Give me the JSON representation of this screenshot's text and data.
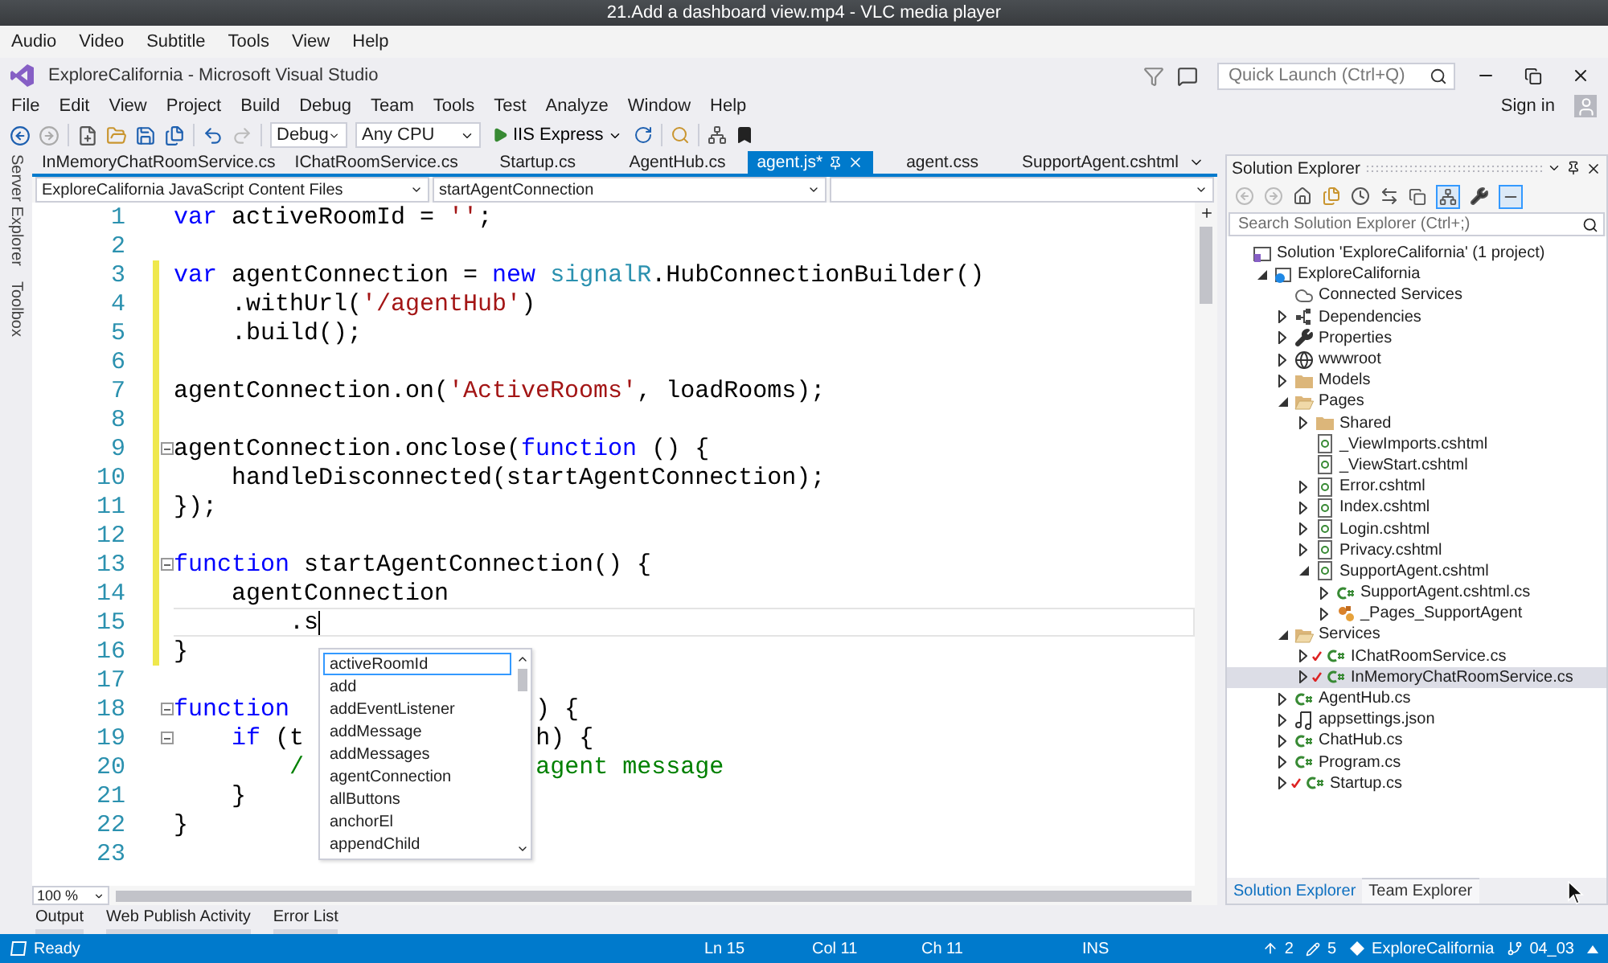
{
  "player": {
    "title": "21.Add a dashboard view.mp4 - VLC media player",
    "menu": [
      "Audio",
      "Video",
      "Subtitle",
      "Tools",
      "View",
      "Help"
    ]
  },
  "window": {
    "title": "ExploreCalifornia - Microsoft Visual Studio",
    "quick_launch": {
      "placeholder": "Quick Launch (Ctrl+Q)"
    }
  },
  "menu": [
    "File",
    "Edit",
    "View",
    "Project",
    "Build",
    "Debug",
    "Team",
    "Tools",
    "Test",
    "Analyze",
    "Window",
    "Help"
  ],
  "account": "Sign in",
  "toolbar": {
    "configuration": "Debug",
    "platform": "Any CPU",
    "run_target": "IIS Express"
  },
  "side_tabs": [
    "Server Explorer",
    "Toolbox"
  ],
  "editor": {
    "tabs": [
      {
        "label": "InMemoryChatRoomService.cs",
        "selected": false
      },
      {
        "label": "IChatRoomService.cs",
        "selected": false
      },
      {
        "label": "Startup.cs",
        "selected": false
      },
      {
        "label": "AgentHub.cs",
        "selected": false
      },
      {
        "label": "agent.js*",
        "selected": true
      },
      {
        "label": "agent.css",
        "selected": false
      },
      {
        "label": "SupportAgent.cshtml",
        "selected": false
      }
    ],
    "navigation": {
      "project": "ExploreCalifornia JavaScript Content Files",
      "member": "startAgentConnection"
    },
    "lines": [
      {
        "number": "1",
        "changed": false,
        "fold": false,
        "current": false,
        "runs": [
          [
            {
              "kind": "kw",
              "text": "var"
            },
            {
              "kind": "plain",
              "text": " activeRoomId = "
            },
            {
              "kind": "str",
              "text": "''"
            },
            {
              "kind": "plain",
              "text": ";"
            }
          ]
        ]
      },
      {
        "number": "2",
        "changed": false,
        "fold": false,
        "current": false
      },
      {
        "number": "3",
        "changed": true,
        "fold": false,
        "current": false,
        "runs": [
          [
            {
              "kind": "kw",
              "text": "var"
            },
            {
              "kind": "plain",
              "text": " agentConnection = "
            },
            {
              "kind": "kw",
              "text": "new"
            },
            {
              "kind": "type",
              "text": " signalR"
            },
            {
              "kind": "plain",
              "text": ".HubConnectionBuilder()"
            }
          ]
        ]
      },
      {
        "number": "4",
        "changed": true,
        "fold": false,
        "current": false,
        "runs": [
          [
            {
              "kind": "plain",
              "text": "    .withUrl("
            },
            {
              "kind": "str",
              "text": "'/agentHub'"
            },
            {
              "kind": "plain",
              "text": ")"
            }
          ]
        ]
      },
      {
        "number": "5",
        "changed": true,
        "fold": false,
        "current": false,
        "runs": [
          [
            {
              "kind": "plain",
              "text": "    .build();"
            }
          ]
        ]
      },
      {
        "number": "6",
        "changed": true,
        "fold": false,
        "current": false
      },
      {
        "number": "7",
        "changed": true,
        "fold": false,
        "current": false,
        "runs": [
          [
            {
              "kind": "plain",
              "text": "agentConnection.on("
            },
            {
              "kind": "str",
              "text": "'ActiveRooms'"
            },
            {
              "kind": "plain",
              "text": ", loadRooms);"
            }
          ]
        ]
      },
      {
        "number": "8",
        "changed": true,
        "fold": false,
        "current": false
      },
      {
        "number": "9",
        "changed": true,
        "fold": true,
        "current": false,
        "runs": [
          [
            {
              "kind": "plain",
              "text": "agentConnection.onclose("
            },
            {
              "kind": "kw",
              "text": "function"
            },
            {
              "kind": "plain",
              "text": " () {"
            }
          ]
        ]
      },
      {
        "number": "10",
        "changed": true,
        "fold": false,
        "current": false,
        "runs": [
          [
            {
              "kind": "plain",
              "text": "    handleDisconnected(startAgentConnection);"
            }
          ]
        ]
      },
      {
        "number": "11",
        "changed": true,
        "fold": false,
        "current": false,
        "runs": [
          [
            {
              "kind": "plain",
              "text": "});"
            }
          ]
        ]
      },
      {
        "number": "12",
        "changed": true,
        "fold": false,
        "current": false
      },
      {
        "number": "13",
        "changed": true,
        "fold": true,
        "current": false,
        "runs": [
          [
            {
              "kind": "kw",
              "text": "function"
            },
            {
              "kind": "plain",
              "text": " startAgentConnection() {"
            }
          ]
        ]
      },
      {
        "number": "14",
        "changed": true,
        "fold": false,
        "current": false,
        "runs": [
          [
            {
              "kind": "plain",
              "text": "    agentConnection"
            }
          ]
        ]
      },
      {
        "number": "15",
        "changed": true,
        "fold": false,
        "current": true,
        "runs": [
          [
            {
              "kind": "plain",
              "text": "        .s"
            }
          ]
        ]
      },
      {
        "number": "16",
        "changed": true,
        "fold": false,
        "current": false,
        "runs": [
          [
            {
              "kind": "plain",
              "text": "}"
            }
          ]
        ]
      },
      {
        "number": "17",
        "changed": false,
        "fold": false,
        "current": false
      },
      {
        "number": "18",
        "changed": false,
        "fold": true,
        "current": false,
        "runs": [
          [
            {
              "kind": "kw",
              "text": "function"
            }
          ],
          [
            {
              "kind": "plain",
              "text": "                 ) {"
            }
          ]
        ]
      },
      {
        "number": "19",
        "changed": false,
        "fold": true,
        "current": false,
        "runs": [
          [
            {
              "kind": "kw",
              "text": "    if"
            },
            {
              "kind": "plain",
              "text": " (t"
            }
          ],
          [
            {
              "kind": "plain",
              "text": "                h) {"
            }
          ]
        ]
      },
      {
        "number": "20",
        "changed": false,
        "fold": false,
        "current": false,
        "runs": [
          [
            {
              "kind": "comment",
              "text": "        /"
            }
          ],
          [
            {
              "kind": "comment",
              "text": "                agent message"
            }
          ]
        ]
      },
      {
        "number": "21",
        "changed": false,
        "fold": false,
        "current": false,
        "runs": [
          [
            {
              "kind": "plain",
              "text": "    }"
            }
          ]
        ]
      },
      {
        "number": "22",
        "changed": false,
        "fold": false,
        "current": false,
        "runs": [
          [
            {
              "kind": "plain",
              "text": "}"
            }
          ]
        ]
      },
      {
        "number": "23",
        "changed": false,
        "fold": false,
        "current": false
      }
    ],
    "completion": {
      "items": [
        {
          "label": "activeRoomId",
          "selected": true
        },
        {
          "label": "add",
          "selected": false
        },
        {
          "label": "addEventListener",
          "selected": false
        },
        {
          "label": "addMessage",
          "selected": false
        },
        {
          "label": "addMessages",
          "selected": false
        },
        {
          "label": "agentConnection",
          "selected": false
        },
        {
          "label": "allButtons",
          "selected": false
        },
        {
          "label": "anchorEl",
          "selected": false
        },
        {
          "label": "appendChild",
          "selected": false
        }
      ]
    },
    "zoom": "100 %"
  },
  "solution_explorer": {
    "title": "Solution Explorer",
    "search": {
      "placeholder": "Search Solution Explorer (Ctrl+;)"
    },
    "tree": [
      {
        "label": "Solution 'ExploreCalifornia' (1 project)",
        "kind": "solution",
        "expandable": false,
        "selected": false,
        "modified": false,
        "children": [
          {
            "label": "ExploreCalifornia",
            "kind": "project",
            "expandable": true,
            "expanded": true,
            "selected": false,
            "modified": false,
            "children": [
              {
                "label": "Connected Services",
                "kind": "cloud",
                "expandable": false,
                "selected": false,
                "modified": false
              },
              {
                "label": "Dependencies",
                "kind": "deps",
                "expandable": true,
                "expanded": false,
                "selected": false,
                "modified": false
              },
              {
                "label": "Properties",
                "kind": "wrench",
                "expandable": true,
                "expanded": false,
                "selected": false,
                "modified": false
              },
              {
                "label": "wwwroot",
                "kind": "globe",
                "expandable": true,
                "expanded": false,
                "selected": false,
                "modified": false
              },
              {
                "label": "Models",
                "kind": "folder",
                "expandable": true,
                "expanded": false,
                "selected": false,
                "modified": false
              },
              {
                "label": "Pages",
                "kind": "folder",
                "expandable": true,
                "expanded": true,
                "selected": false,
                "modified": false,
                "children": [
                  {
                    "label": "Shared",
                    "kind": "folder",
                    "expandable": true,
                    "expanded": false,
                    "selected": false,
                    "modified": false
                  },
                  {
                    "label": "_ViewImports.cshtml",
                    "kind": "page",
                    "expandable": false,
                    "selected": false,
                    "modified": false
                  },
                  {
                    "label": "_ViewStart.cshtml",
                    "kind": "page",
                    "expandable": false,
                    "selected": false,
                    "modified": false
                  },
                  {
                    "label": "Error.cshtml",
                    "kind": "page",
                    "expandable": true,
                    "expanded": false,
                    "selected": false,
                    "modified": false
                  },
                  {
                    "label": "Index.cshtml",
                    "kind": "page",
                    "expandable": true,
                    "expanded": false,
                    "selected": false,
                    "modified": false
                  },
                  {
                    "label": "Login.cshtml",
                    "kind": "page",
                    "expandable": true,
                    "expanded": false,
                    "selected": false,
                    "modified": false
                  },
                  {
                    "label": "Privacy.cshtml",
                    "kind": "page",
                    "expandable": true,
                    "expanded": false,
                    "selected": false,
                    "modified": false
                  },
                  {
                    "label": "SupportAgent.cshtml",
                    "kind": "page",
                    "expandable": true,
                    "expanded": true,
                    "selected": false,
                    "modified": false,
                    "children": [
                      {
                        "label": "SupportAgent.cshtml.cs",
                        "kind": "code",
                        "expandable": true,
                        "expanded": false,
                        "selected": false,
                        "modified": false
                      },
                      {
                        "label": "_Pages_SupportAgent",
                        "kind": "component",
                        "expandable": true,
                        "expanded": false,
                        "selected": false,
                        "modified": false
                      }
                    ]
                  }
                ]
              },
              {
                "label": "Services",
                "kind": "folder",
                "expandable": true,
                "expanded": true,
                "selected": false,
                "modified": false,
                "children": [
                  {
                    "label": "IChatRoomService.cs",
                    "kind": "code",
                    "expandable": true,
                    "expanded": false,
                    "selected": false,
                    "modified": true
                  },
                  {
                    "label": "InMemoryChatRoomService.cs",
                    "kind": "code",
                    "expandable": true,
                    "expanded": false,
                    "selected": true,
                    "modified": true
                  }
                ]
              },
              {
                "label": "AgentHub.cs",
                "kind": "code",
                "expandable": true,
                "expanded": false,
                "selected": false,
                "modified": false
              },
              {
                "label": "appsettings.json",
                "kind": "json",
                "expandable": true,
                "expanded": false,
                "selected": false,
                "modified": false
              },
              {
                "label": "ChatHub.cs",
                "kind": "code",
                "expandable": true,
                "expanded": false,
                "selected": false,
                "modified": false
              },
              {
                "label": "Program.cs",
                "kind": "code",
                "expandable": true,
                "expanded": false,
                "selected": false,
                "modified": false
              },
              {
                "label": "Startup.cs",
                "kind": "code",
                "expandable": true,
                "expanded": false,
                "selected": false,
                "modified": true
              }
            ]
          }
        ]
      }
    ],
    "tabs": [
      {
        "label": "Solution Explorer",
        "selected": true
      },
      {
        "label": "Team Explorer",
        "selected": false
      }
    ]
  },
  "bottom_tabs": [
    "Output",
    "Web Publish Activity",
    "Error List"
  ],
  "status_bar": {
    "message": "Ready",
    "line": "Ln 15",
    "column": "Col 11",
    "char": "Ch 11",
    "mode": "INS",
    "pushes": "2",
    "changes": "5",
    "repository": "ExploreCalifornia",
    "branch": "04_03"
  }
}
